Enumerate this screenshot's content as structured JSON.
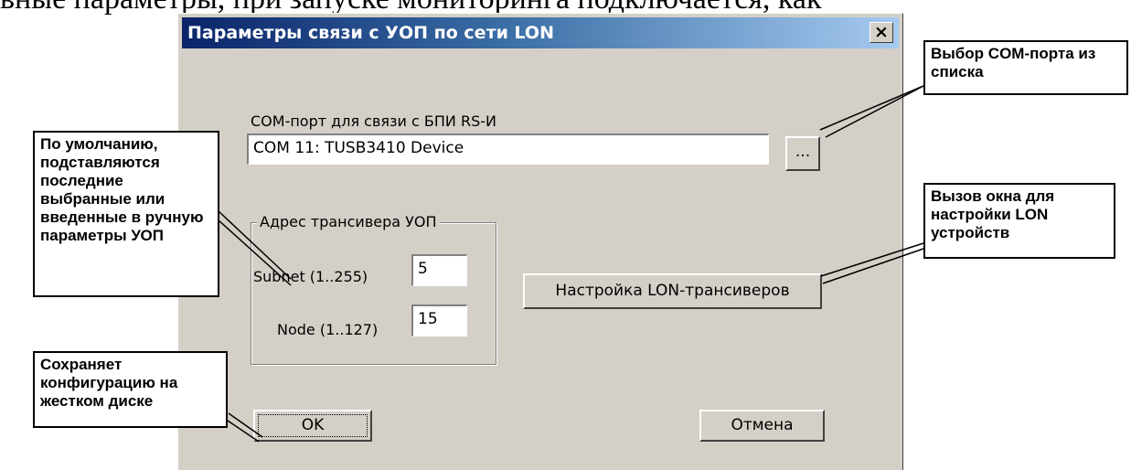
{
  "page_top_text": "вные параметры, при запуске мониторинга подключается, как",
  "dialog": {
    "title": "Параметры связи с УОП по сети  LON",
    "close_label": "×",
    "com_label": "COM-порт для связи с  БПИ RS-И",
    "com_value": "COM 11: TUSB3410 Device",
    "browse_label": "...",
    "group_title": "Адрес трансивера УОП",
    "subnet_label": "Subnet (1..255)",
    "subnet_value": "5",
    "node_label": "Node (1..127)",
    "node_value": "15",
    "lon_button": "Настройка LON-трансиверов",
    "ok_button": "OK",
    "cancel_button": "Отмена"
  },
  "callouts": {
    "com_select": "Выбор COM-порта из списка",
    "defaults": "По умолчанию, подставляются последние выбранные  или введенные в ручную параметры УОП",
    "lon_window": "Вызов окна для настройки LON устройств",
    "save": "Сохраняет конфигурацию на жестком диске"
  },
  "colors": {
    "dialog_bg": "#d4d0c8",
    "titlebar_start": "#0a246a",
    "titlebar_end": "#a6caf0"
  }
}
